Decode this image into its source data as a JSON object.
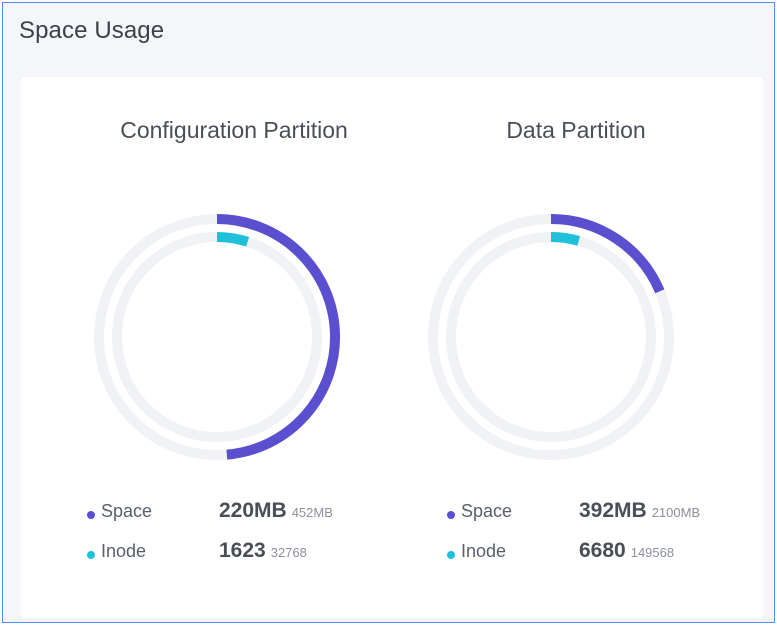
{
  "panel": {
    "title": "Space Usage"
  },
  "colors": {
    "space": "#5a4fcf",
    "inode": "#1ec1d9",
    "track": "#f1f2f5",
    "frame_border": "#4f8ff7"
  },
  "partitions": [
    {
      "title": "Configuration Partition",
      "space": {
        "label": "Space",
        "used": "220MB",
        "total": "452MB",
        "ratio": 0.4867
      },
      "inode": {
        "label": "Inode",
        "used": "1623",
        "total": "32768",
        "ratio": 0.0495
      }
    },
    {
      "title": "Data Partition",
      "space": {
        "label": "Space",
        "used": "392MB",
        "total": "2100MB",
        "ratio": 0.1867
      },
      "inode": {
        "label": "Inode",
        "used": "6680",
        "total": "149568",
        "ratio": 0.0447
      }
    }
  ]
}
